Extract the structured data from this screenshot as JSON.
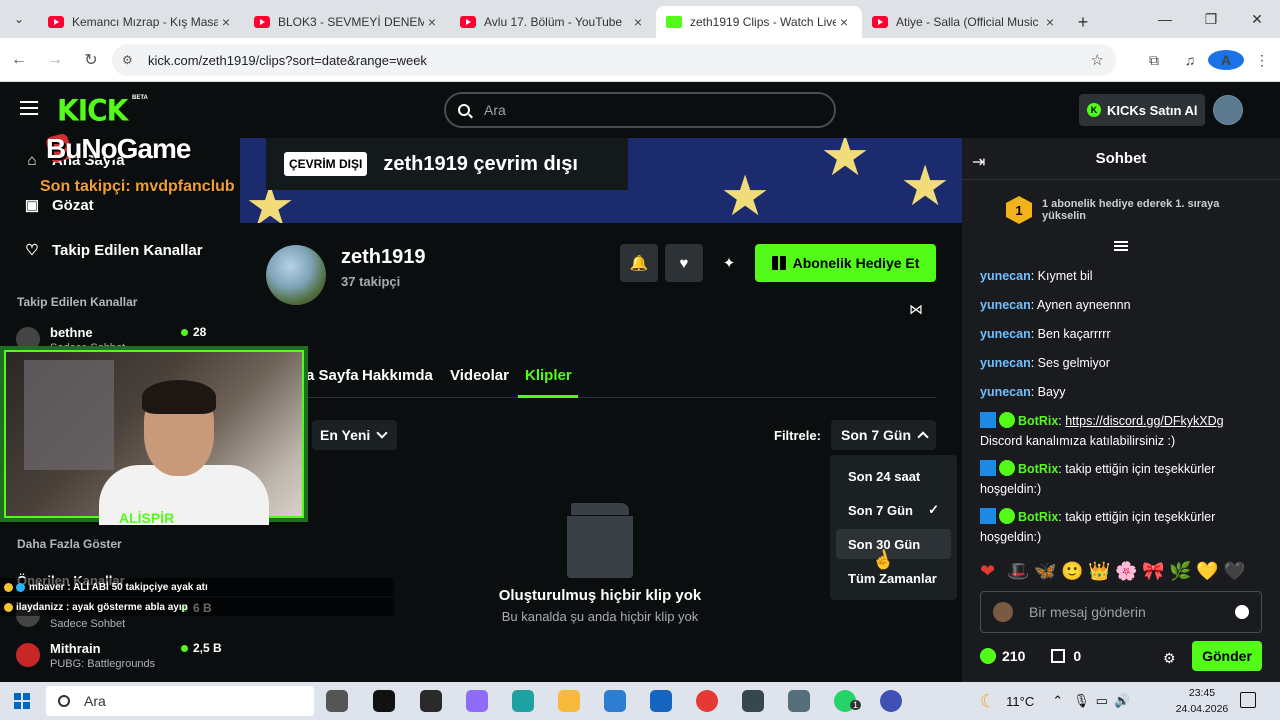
{
  "browser": {
    "tabs": [
      {
        "title": "Kemancı Mızrap - Kış Masalı",
        "icon": "youtube-icon"
      },
      {
        "title": "BLOK3 - SEVMEYİ DENEMEDİN",
        "icon": "youtube-icon"
      },
      {
        "title": "Avlu 17. Bölüm - YouTube",
        "icon": "youtube-icon"
      },
      {
        "title": "zeth1919 Clips - Watch Live",
        "icon": "kick-icon",
        "active": true
      },
      {
        "title": "Atiye - Salla (Official Music Video)",
        "icon": "youtube-icon"
      }
    ],
    "url": "kick.com/zeth1919/clips?sort=date&range=week",
    "profile_initial": "A"
  },
  "header": {
    "logo": "KICK",
    "beta": "BETA",
    "search_placeholder": "Ara",
    "kicks_button": "KICKs Satın Al"
  },
  "sidebar": {
    "nav": [
      "Ana Sayfa",
      "Gözat",
      "Takip Edilen Kanallar"
    ],
    "followed_heading": "Takip Edilen Kanallar",
    "show_more": "Daha Fazla Göster",
    "recommended_heading": "Önerilen Kanallar",
    "channels": [
      {
        "name": "bethne",
        "game": "Sadece Sohbet",
        "count": "28"
      },
      {
        "name": "Mithrain",
        "game": "PUBG: Battlegrounds",
        "count": "2,5 B"
      }
    ],
    "sohbet_channel": {
      "game": "Sadece Sohbet",
      "count": "6 B"
    }
  },
  "overlay": {
    "brand": "BuNoGame",
    "last_follower": "Son takipçi: mvdpfanclub",
    "cam_label": "ALİSPİR",
    "alerts": [
      "mbaver : ALİ ABİ 50 takipçiye ayak atı",
      "ilaydanizz : ayak gösterme abla ayıp"
    ]
  },
  "channel": {
    "offline_tag": "ÇEVRİM DIŞI",
    "offline_text": "zeth1919 çevrim dışı",
    "name": "zeth1919",
    "followers": "37 takipçi",
    "subscribe_gift": "Abonelik Hediye Et",
    "tabs": [
      "Ana Sayfa",
      "Hakkımda",
      "Videolar",
      "Klipler"
    ],
    "active_tab": "Klipler",
    "sort_label": "En Yeni",
    "filter_label": "Filtrele:",
    "filter_value": "Son 7 Gün",
    "filter_options": [
      {
        "label": "Son 24 saat"
      },
      {
        "label": "Son 7 Gün",
        "selected": true
      },
      {
        "label": "Son 30 Gün",
        "hover": true
      },
      {
        "label": "Tüm Zamanlar"
      }
    ],
    "empty_title": "Oluşturulmuş hiçbir klip yok",
    "empty_sub": "Bu kanalda şu anda hiçbir klip yok"
  },
  "chat": {
    "title": "Sohbet",
    "gift_rank": "1",
    "gift_banner": "1 abonelik hediye ederek 1. sıraya yükselin",
    "messages": [
      {
        "user": "yunecan",
        "text": "Kıymet bil"
      },
      {
        "user": "yunecan",
        "text": "Aynen ayneennn"
      },
      {
        "user": "yunecan",
        "text": "Ben kaçarrrrr"
      },
      {
        "user": "yunecan",
        "text": "Ses gelmiyor"
      },
      {
        "user": "yunecan",
        "text": "Bayy"
      },
      {
        "user": "BotRix",
        "link": "https://discord.gg/DFkykXDg",
        "text": "Discord kanalımıza katılabilirsiniz :)"
      },
      {
        "user": "BotRix",
        "text": "takip ettiğin için teşekkürler hoşgeldin:)"
      },
      {
        "user": "BotRix",
        "text": "takip ettiğin için teşekkürler hoşgeldin:)"
      }
    ],
    "emojis": [
      "❤",
      "🎩",
      "🦋",
      "🙂",
      "👑",
      "🌸",
      "🎀",
      "🌿",
      "💛",
      "🖤"
    ],
    "input_placeholder": "Bir mesaj gönderin",
    "points": "210",
    "boxes": "0",
    "send": "Gönder"
  },
  "taskbar": {
    "search": "Ara",
    "temperature": "11°C",
    "time": "23:45",
    "date": "24.04.2026",
    "badge": "1"
  }
}
